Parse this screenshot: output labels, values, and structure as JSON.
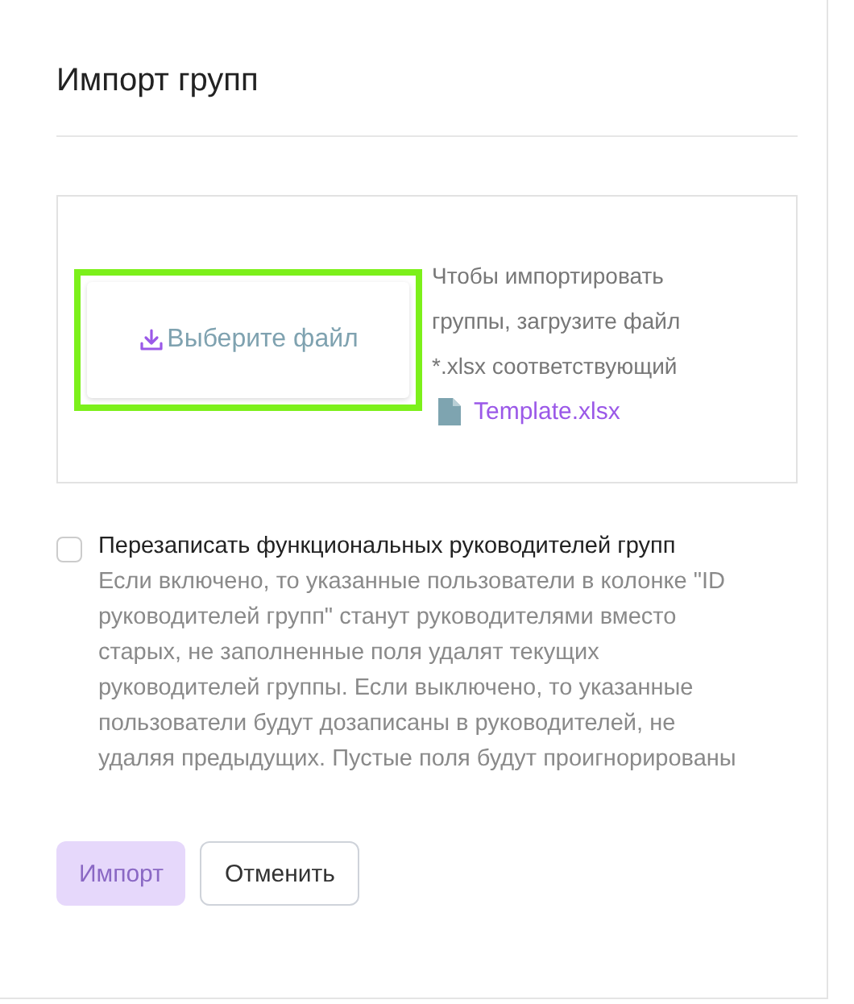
{
  "dialog": {
    "title": "Импорт групп"
  },
  "upload": {
    "button": "Выберите файл",
    "highlighted": true,
    "hint": "Чтобы импортировать группы, загрузите файл *.xlsx соответствующий",
    "template_link": "Template.xlsx"
  },
  "option": {
    "label": "Перезаписать функциональных руководителей групп",
    "checked": false,
    "description": "Если включено, то указанные пользователи в колонке \"ID руководителей групп\" станут руководителями вместо старых, не заполненные поля удалят текущих руководителей группы. Если выключено, то указанные пользователи будут дозаписаны в руководителей, не удаляя предыдущих. Пустые поля будут проигнорированы"
  },
  "buttons": [
    {
      "label": "Импорт",
      "kind": "primary",
      "disabled": true
    },
    {
      "label": "Отменить",
      "kind": "secondary",
      "disabled": false
    }
  ]
}
